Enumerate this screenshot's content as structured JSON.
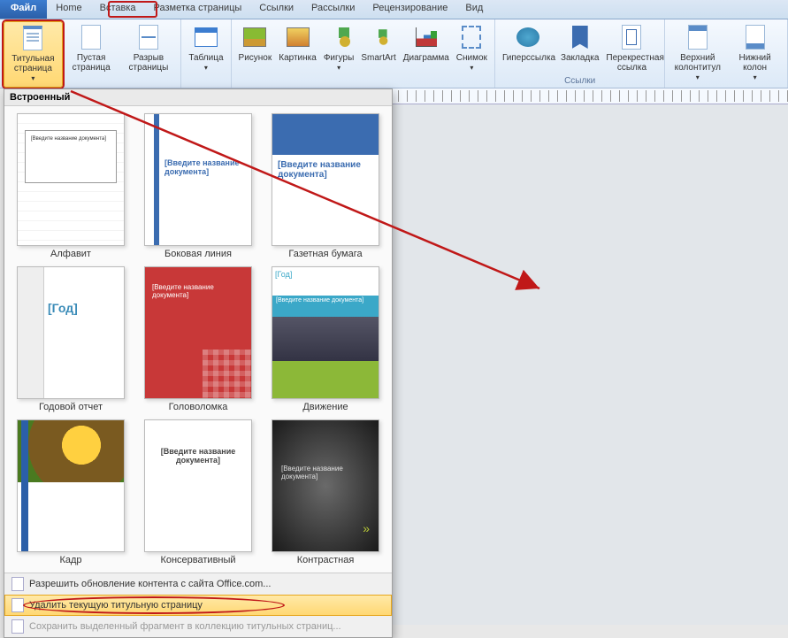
{
  "tabs": {
    "file": "Файл",
    "home": "Home",
    "insert": "Вставка",
    "layout": "Разметка страницы",
    "refs": "Ссылки",
    "mail": "Рассылки",
    "review": "Рецензирование",
    "view": "Вид"
  },
  "ribbon": {
    "titlePage": "Титульная страница",
    "blankPage": "Пустая страница",
    "pageBreak": "Разрыв страницы",
    "table": "Таблица",
    "picture": "Рисунок",
    "clipart": "Картинка",
    "shapes": "Фигуры",
    "smartart": "SmartArt",
    "chart": "Диаграмма",
    "snapshot": "Снимок",
    "hyperlink": "Гиперссылка",
    "bookmark": "Закладка",
    "crossref": "Перекрестная ссылка",
    "header": "Верхний колонтитул",
    "footer": "Нижний колон",
    "groupLinks": "Ссылки"
  },
  "gallery": {
    "header": "Встроенный",
    "thumbs": [
      {
        "label": "Алфавит"
      },
      {
        "label": "Боковая линия"
      },
      {
        "label": "Газетная бумага"
      },
      {
        "label": "Годовой отчет"
      },
      {
        "label": "Головоломка"
      },
      {
        "label": "Движение"
      },
      {
        "label": "Кадр"
      },
      {
        "label": "Консервативный"
      },
      {
        "label": "Контрастная"
      }
    ],
    "thumbText": {
      "enterDoc": "[Введите название документа]",
      "enterDocShort": "[Введите название документа]",
      "year": "[Год]"
    },
    "footer": {
      "office": "Разрешить обновление контента с сайта Office.com...",
      "delete": "Удалить текущую титульную страницу",
      "save": "Сохранить выделенный фрагмент в коллекцию титульных страниц..."
    }
  }
}
